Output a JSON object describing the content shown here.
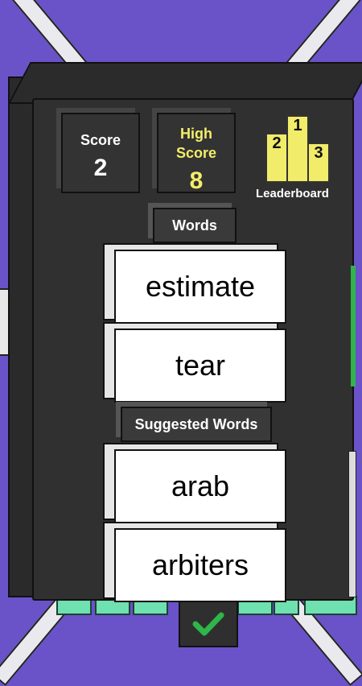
{
  "score": {
    "label": "Score",
    "value": "2"
  },
  "high_score": {
    "label_line1": "High",
    "label_line2": "Score",
    "value": "8"
  },
  "leaderboard": {
    "label": "Leaderboard",
    "podium": [
      "2",
      "1",
      "3"
    ]
  },
  "words_header": "Words",
  "words": [
    "estimate",
    "tear"
  ],
  "suggested_header": "Suggested Words",
  "suggested_words": [
    "arab",
    "arbiters"
  ],
  "colors": {
    "background": "#6a52c9",
    "panel": "#303030",
    "accent_yellow": "#f3ee6a",
    "check_green": "#2fb54a"
  },
  "icons": {
    "confirm": "check-icon",
    "leaderboard": "podium-icon"
  }
}
